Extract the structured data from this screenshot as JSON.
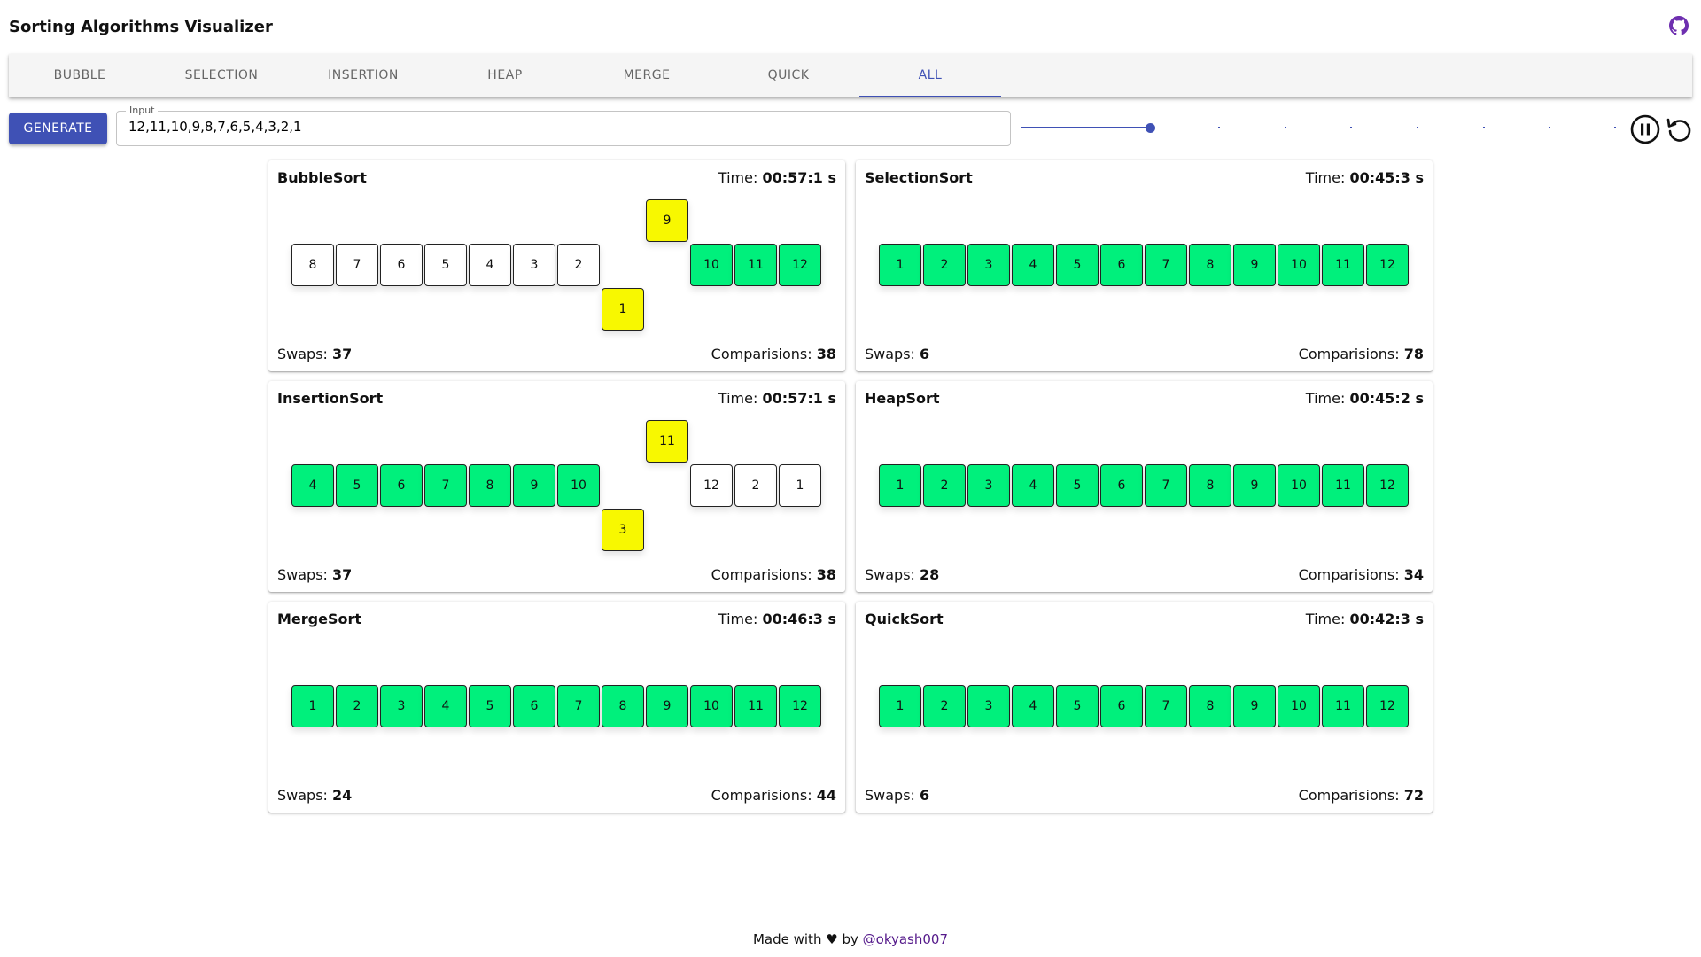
{
  "app": {
    "title": "Sorting Algorithms Visualizer",
    "github_icon": "github-icon"
  },
  "tabs": [
    {
      "label": "BUBBLE",
      "active": false
    },
    {
      "label": "SELECTION",
      "active": false
    },
    {
      "label": "INSERTION",
      "active": false
    },
    {
      "label": "HEAP",
      "active": false
    },
    {
      "label": "MERGE",
      "active": false
    },
    {
      "label": "QUICK",
      "active": false
    },
    {
      "label": "ALL",
      "active": true
    }
  ],
  "controls": {
    "generate_label": "GENERATE",
    "input_label": "Input",
    "input_value": "12,11,10,9,8,7,6,5,4,3,2,1",
    "speed_value": 2,
    "speed_max": 9,
    "pause_icon": "pause-circle-icon",
    "reset_icon": "reset-icon"
  },
  "labels": {
    "time_prefix": "Time:",
    "swaps_prefix": "Swaps:",
    "comparisons_prefix": "Comparisions:"
  },
  "colors": {
    "primary": "#3f51b5",
    "sorted": "#00f07c",
    "active": "#f8f800",
    "default": "#ffffff"
  },
  "cards": [
    {
      "name": "BubbleSort",
      "time": "00:57:1 s",
      "swaps": "37",
      "comparisons": "38",
      "cells": [
        {
          "v": "8",
          "state": "default",
          "row": "mid"
        },
        {
          "v": "7",
          "state": "default",
          "row": "mid"
        },
        {
          "v": "6",
          "state": "default",
          "row": "mid"
        },
        {
          "v": "5",
          "state": "default",
          "row": "mid"
        },
        {
          "v": "4",
          "state": "default",
          "row": "mid"
        },
        {
          "v": "3",
          "state": "default",
          "row": "mid"
        },
        {
          "v": "2",
          "state": "default",
          "row": "mid"
        },
        {
          "v": "1",
          "state": "active",
          "row": "low"
        },
        {
          "v": "9",
          "state": "active",
          "row": "high"
        },
        {
          "v": "10",
          "state": "done",
          "row": "mid"
        },
        {
          "v": "11",
          "state": "done",
          "row": "mid"
        },
        {
          "v": "12",
          "state": "done",
          "row": "mid"
        }
      ]
    },
    {
      "name": "SelectionSort",
      "time": "00:45:3 s",
      "swaps": "6",
      "comparisons": "78",
      "cells": [
        {
          "v": "1",
          "state": "done",
          "row": "mid"
        },
        {
          "v": "2",
          "state": "done",
          "row": "mid"
        },
        {
          "v": "3",
          "state": "done",
          "row": "mid"
        },
        {
          "v": "4",
          "state": "done",
          "row": "mid"
        },
        {
          "v": "5",
          "state": "done",
          "row": "mid"
        },
        {
          "v": "6",
          "state": "done",
          "row": "mid"
        },
        {
          "v": "7",
          "state": "done",
          "row": "mid"
        },
        {
          "v": "8",
          "state": "done",
          "row": "mid"
        },
        {
          "v": "9",
          "state": "done",
          "row": "mid"
        },
        {
          "v": "10",
          "state": "done",
          "row": "mid"
        },
        {
          "v": "11",
          "state": "done",
          "row": "mid"
        },
        {
          "v": "12",
          "state": "done",
          "row": "mid"
        }
      ]
    },
    {
      "name": "InsertionSort",
      "time": "00:57:1 s",
      "swaps": "37",
      "comparisons": "38",
      "cells": [
        {
          "v": "4",
          "state": "done",
          "row": "mid"
        },
        {
          "v": "5",
          "state": "done",
          "row": "mid"
        },
        {
          "v": "6",
          "state": "done",
          "row": "mid"
        },
        {
          "v": "7",
          "state": "done",
          "row": "mid"
        },
        {
          "v": "8",
          "state": "done",
          "row": "mid"
        },
        {
          "v": "9",
          "state": "done",
          "row": "mid"
        },
        {
          "v": "10",
          "state": "done",
          "row": "mid"
        },
        {
          "v": "3",
          "state": "active",
          "row": "low"
        },
        {
          "v": "11",
          "state": "active",
          "row": "high"
        },
        {
          "v": "12",
          "state": "default",
          "row": "mid"
        },
        {
          "v": "2",
          "state": "default",
          "row": "mid"
        },
        {
          "v": "1",
          "state": "default",
          "row": "mid"
        }
      ]
    },
    {
      "name": "HeapSort",
      "time": "00:45:2 s",
      "swaps": "28",
      "comparisons": "34",
      "cells": [
        {
          "v": "1",
          "state": "done",
          "row": "mid"
        },
        {
          "v": "2",
          "state": "done",
          "row": "mid"
        },
        {
          "v": "3",
          "state": "done",
          "row": "mid"
        },
        {
          "v": "4",
          "state": "done",
          "row": "mid"
        },
        {
          "v": "5",
          "state": "done",
          "row": "mid"
        },
        {
          "v": "6",
          "state": "done",
          "row": "mid"
        },
        {
          "v": "7",
          "state": "done",
          "row": "mid"
        },
        {
          "v": "8",
          "state": "done",
          "row": "mid"
        },
        {
          "v": "9",
          "state": "done",
          "row": "mid"
        },
        {
          "v": "10",
          "state": "done",
          "row": "mid"
        },
        {
          "v": "11",
          "state": "done",
          "row": "mid"
        },
        {
          "v": "12",
          "state": "done",
          "row": "mid"
        }
      ]
    },
    {
      "name": "MergeSort",
      "time": "00:46:3 s",
      "swaps": "24",
      "comparisons": "44",
      "cells": [
        {
          "v": "1",
          "state": "done",
          "row": "mid"
        },
        {
          "v": "2",
          "state": "done",
          "row": "mid"
        },
        {
          "v": "3",
          "state": "done",
          "row": "mid"
        },
        {
          "v": "4",
          "state": "done",
          "row": "mid"
        },
        {
          "v": "5",
          "state": "done",
          "row": "mid"
        },
        {
          "v": "6",
          "state": "done",
          "row": "mid"
        },
        {
          "v": "7",
          "state": "done",
          "row": "mid"
        },
        {
          "v": "8",
          "state": "done",
          "row": "mid"
        },
        {
          "v": "9",
          "state": "done",
          "row": "mid"
        },
        {
          "v": "10",
          "state": "done",
          "row": "mid"
        },
        {
          "v": "11",
          "state": "done",
          "row": "mid"
        },
        {
          "v": "12",
          "state": "done",
          "row": "mid"
        }
      ]
    },
    {
      "name": "QuickSort",
      "time": "00:42:3 s",
      "swaps": "6",
      "comparisons": "72",
      "cells": [
        {
          "v": "1",
          "state": "done",
          "row": "mid"
        },
        {
          "v": "2",
          "state": "done",
          "row": "mid"
        },
        {
          "v": "3",
          "state": "done",
          "row": "mid"
        },
        {
          "v": "4",
          "state": "done",
          "row": "mid"
        },
        {
          "v": "5",
          "state": "done",
          "row": "mid"
        },
        {
          "v": "6",
          "state": "done",
          "row": "mid"
        },
        {
          "v": "7",
          "state": "done",
          "row": "mid"
        },
        {
          "v": "8",
          "state": "done",
          "row": "mid"
        },
        {
          "v": "9",
          "state": "done",
          "row": "mid"
        },
        {
          "v": "10",
          "state": "done",
          "row": "mid"
        },
        {
          "v": "11",
          "state": "done",
          "row": "mid"
        },
        {
          "v": "12",
          "state": "done",
          "row": "mid"
        }
      ]
    }
  ],
  "footer": {
    "prefix": "Made with",
    "heart": "♥",
    "by": "by",
    "link": "@okyash007"
  }
}
